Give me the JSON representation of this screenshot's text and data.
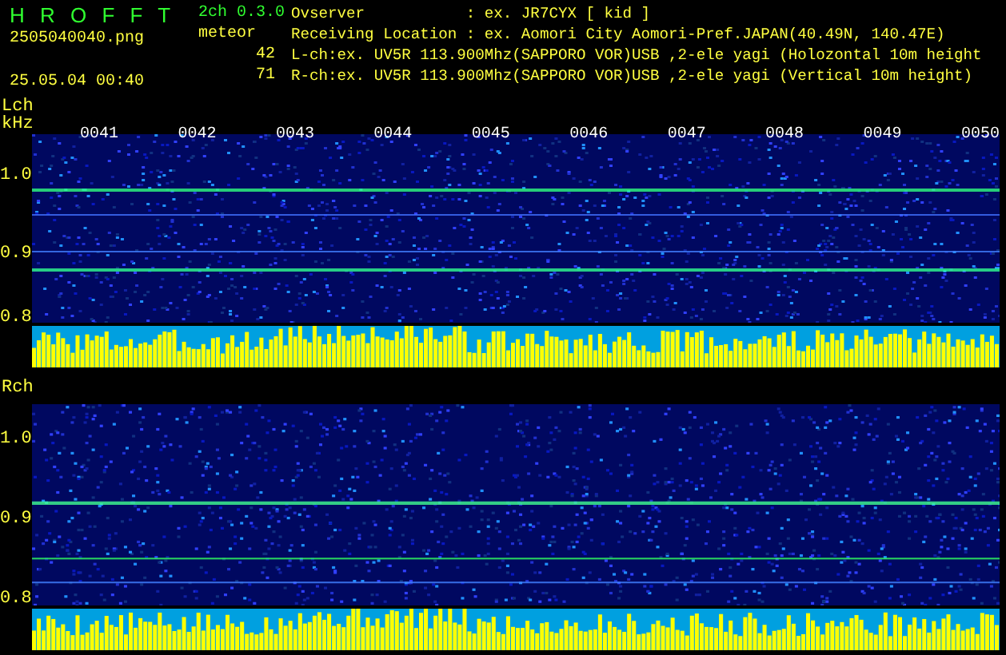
{
  "header": {
    "app_title": "H R O F F T",
    "version": "2ch 0.3.0",
    "filename": "2505040040.png",
    "mode": "meteor",
    "timestamp": "25.05.04 00:40",
    "counts": [
      "42",
      "71"
    ],
    "info_lines": [
      "Ovserver           : ex. JR7CYX [ kid ]",
      "Receiving Location : ex. Aomori City Aomori-Pref.JAPAN(40.49N, 140.47E)",
      "L-ch:ex. UV5R 113.900Mhz(SAPPORO VOR)USB ,2-ele yagi (Holozontal 10m height",
      "R-ch:ex. UV5R 113.900Mhz(SAPPORO VOR)USB ,2-ele yagi (Vertical 10m height)"
    ]
  },
  "channels": [
    {
      "label": "Lch",
      "unit": "kHz",
      "time_labels": [
        "0041",
        "0042",
        "0043",
        "0044",
        "0045",
        "0046",
        "0047",
        "0048",
        "0049",
        "0050"
      ],
      "y_labels": [
        "1.0",
        "0.9",
        "0.8"
      ]
    },
    {
      "label": "Rch",
      "y_labels": [
        "1.0",
        "0.9",
        "0.8"
      ]
    }
  ]
}
